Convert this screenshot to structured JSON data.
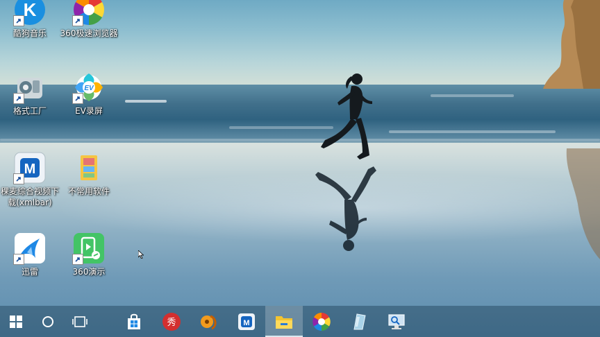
{
  "desktop": {
    "icons": [
      {
        "label": "酷狗音乐",
        "icon": "kugou-music-icon"
      },
      {
        "label": "360极速浏览器",
        "icon": "360-speed-browser-icon"
      },
      {
        "label": "格式工厂",
        "icon": "format-factory-icon"
      },
      {
        "label": "EV录屏",
        "icon": "ev-screen-recorder-icon"
      },
      {
        "label": "稞麦综合视频下载(xmlbar)",
        "icon": "xmlbar-downloader-icon"
      },
      {
        "label": "不常用软件",
        "icon": "folder-icon"
      },
      {
        "label": "迅雷",
        "icon": "xunlei-icon"
      },
      {
        "label": "360演示",
        "icon": "360-presentation-icon"
      }
    ]
  },
  "taskbar": {
    "buttons": [
      {
        "name": "start-button",
        "icon": "windows-logo-icon"
      },
      {
        "name": "cortana-search-button",
        "icon": "circle-icon"
      },
      {
        "name": "task-view-button",
        "icon": "task-view-icon"
      }
    ],
    "pinned": [
      {
        "name": "windows-store",
        "icon": "store-bag-icon"
      },
      {
        "name": "xiu-app",
        "icon": "xiu-icon",
        "glyph": "秀"
      },
      {
        "name": "media-app",
        "icon": "film-reel-icon"
      },
      {
        "name": "xmlbar-app",
        "icon": "xmlbar-icon"
      },
      {
        "name": "file-explorer",
        "icon": "folder-icon",
        "active": true
      },
      {
        "name": "360-browser",
        "icon": "360-browser-icon"
      },
      {
        "name": "glass-app",
        "icon": "glass-icon"
      },
      {
        "name": "remote-desktop",
        "icon": "monitor-search-icon"
      }
    ]
  },
  "colors": {
    "sky": "#8fbfd0",
    "sea": "#2f6280",
    "sand": "#8eb0c4",
    "taskbar": "#0a283c",
    "active_highlight": "#dbe8f0"
  }
}
